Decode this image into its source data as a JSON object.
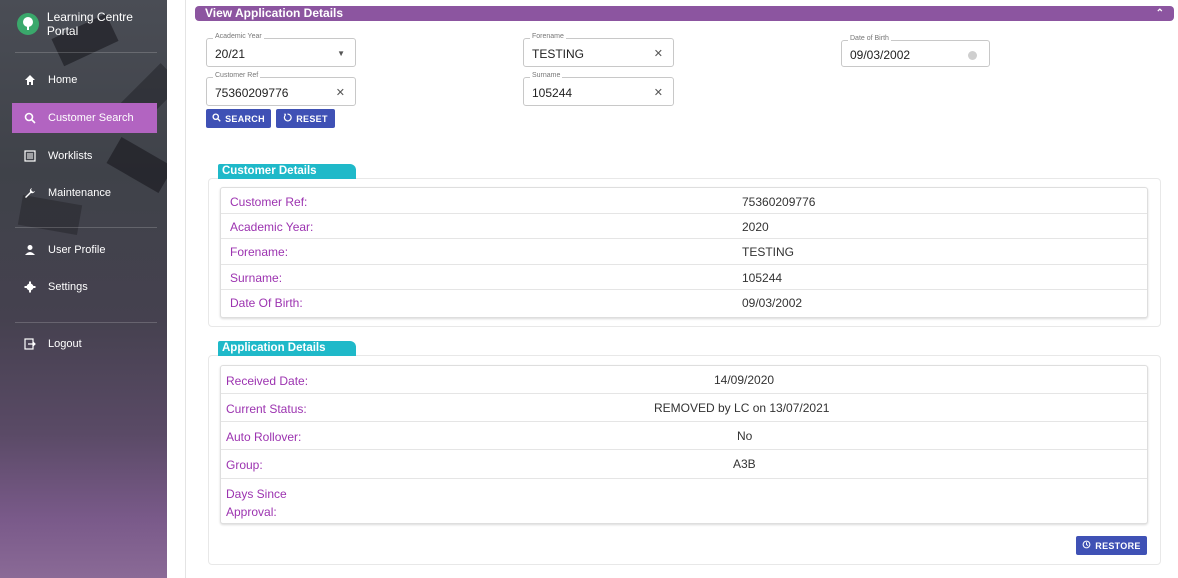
{
  "sidebar": {
    "title": "Learning Centre Portal",
    "items": [
      {
        "label": "Home",
        "icon": "home-icon"
      },
      {
        "label": "Customer Search",
        "icon": "search-icon",
        "active": true
      },
      {
        "label": "Worklists",
        "icon": "list-icon"
      },
      {
        "label": "Maintenance",
        "icon": "wrench-icon"
      },
      {
        "label": "User Profile",
        "icon": "person-icon"
      },
      {
        "label": "Settings",
        "icon": "gear-icon"
      },
      {
        "label": "Logout",
        "icon": "logout-icon"
      }
    ]
  },
  "header": {
    "title": "View Application Details"
  },
  "search": {
    "academic_year": {
      "label": "Academic Year",
      "value": "20/21"
    },
    "forename": {
      "label": "Forename",
      "value": "TESTING"
    },
    "date_of_birth": {
      "label": "Date of Birth",
      "value": "09/03/2002"
    },
    "customer_ref": {
      "label": "Customer Ref",
      "value": "75360209776"
    },
    "surname": {
      "label": "Surname",
      "value": "105244"
    },
    "search_label": "SEARCH",
    "reset_label": "RESET"
  },
  "customer_details": {
    "title": "Customer Details",
    "rows": [
      {
        "label": "Customer Ref:",
        "value": "75360209776"
      },
      {
        "label": "Academic Year:",
        "value": "2020"
      },
      {
        "label": "Forename:",
        "value": "TESTING"
      },
      {
        "label": "Surname:",
        "value": "105244"
      },
      {
        "label": "Date Of Birth:",
        "value": "09/03/2002"
      }
    ]
  },
  "application_details": {
    "title": "Application Details",
    "rows": [
      {
        "label": "Received Date:",
        "value": "14/09/2020"
      },
      {
        "label": "Current Status:",
        "value": "REMOVED by LC on 13/07/2021"
      },
      {
        "label": "Auto Rollover:",
        "value": "No"
      },
      {
        "label": "Group:",
        "value": "A3B"
      },
      {
        "label": "Days Since Approval:",
        "value": ""
      }
    ],
    "restore_label": "RESTORE"
  },
  "colors": {
    "sidebar_active": "#b264c1",
    "header_purple": "#8c55a0",
    "section_teal": "#1fb9c9",
    "button_blue": "#3f51b5",
    "label_purple": "#9c33b0"
  }
}
